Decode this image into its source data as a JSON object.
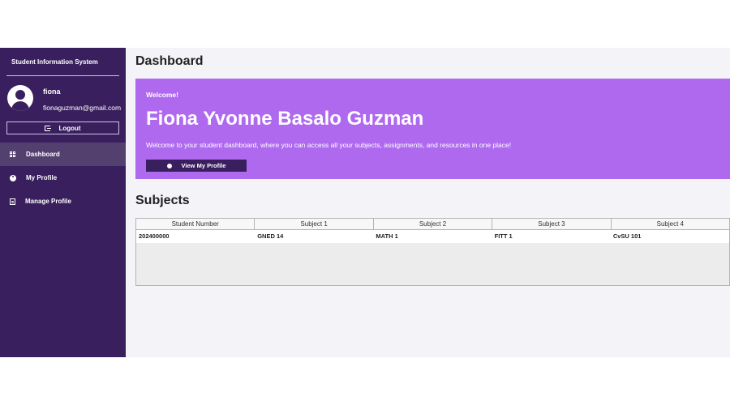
{
  "sidebar": {
    "app_title": "Student Information System",
    "user": {
      "name": "fiona",
      "email": "fionaguzman@gmail.com"
    },
    "logout_label": "Logout",
    "items": [
      {
        "label": "Dashboard",
        "icon": "grid-icon",
        "active": true
      },
      {
        "label": "My Profile",
        "icon": "user-circle-icon",
        "active": false
      },
      {
        "label": "Manage Profile",
        "icon": "edit-doc-icon",
        "active": false
      }
    ]
  },
  "main": {
    "page_title": "Dashboard",
    "banner": {
      "welcome": "Welcome!",
      "full_name": "Fiona Yvonne Basalo Guzman",
      "description": "Welcome to your student dashboard, where you can access all your subjects, assignments, and resources in one place!",
      "button_label": "View My Profile"
    },
    "subjects": {
      "title": "Subjects",
      "columns": [
        "Student Number",
        "Subject 1",
        "Subject 2",
        "Subject 3",
        "Subject 4"
      ],
      "rows": [
        [
          "202400000",
          "GNED 14",
          "MATH 1",
          "FITT 1",
          "CvSU 101"
        ]
      ]
    }
  },
  "colors": {
    "sidebar_bg": "#3a1f5e",
    "active_item_bg": "#53406f",
    "banner_bg": "#af69ef",
    "main_bg": "#f4f4f8"
  }
}
